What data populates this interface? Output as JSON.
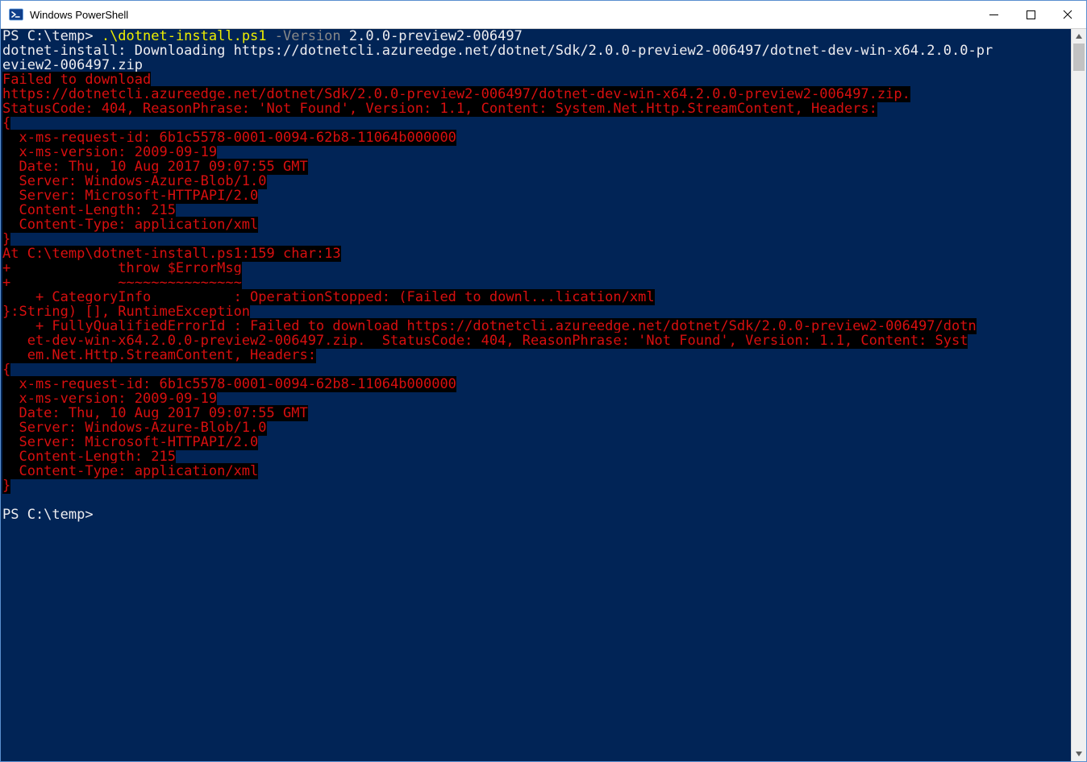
{
  "window": {
    "title": "Windows PowerShell"
  },
  "prompt1": {
    "ps": "PS C:\\temp> ",
    "cmd": ".\\dotnet-install.ps1 ",
    "flag": "-Version ",
    "arg": "2.0.0-preview2-006497"
  },
  "out": {
    "l1": "dotnet-install: Downloading https://dotnetcli.azureedge.net/dotnet/Sdk/2.0.0-preview2-006497/dotnet-dev-win-x64.2.0.0-pr",
    "l2": "eview2-006497.zip"
  },
  "err": {
    "e01": "Failed to download",
    "e02": "https://dotnetcli.azureedge.net/dotnet/Sdk/2.0.0-preview2-006497/dotnet-dev-win-x64.2.0.0-preview2-006497.zip.",
    "e03": "StatusCode: 404, ReasonPhrase: 'Not Found', Version: 1.1, Content: System.Net.Http.StreamContent, Headers:",
    "e04": "{",
    "e05": "  x-ms-request-id: 6b1c5578-0001-0094-62b8-11064b000000",
    "e06": "  x-ms-version: 2009-09-19",
    "e07": "  Date: Thu, 10 Aug 2017 09:07:55 GMT",
    "e08": "  Server: Windows-Azure-Blob/1.0",
    "e09": "  Server: Microsoft-HTTPAPI/2.0",
    "e10": "  Content-Length: 215",
    "e11": "  Content-Type: application/xml",
    "e12": "}",
    "e13": "At C:\\temp\\dotnet-install.ps1:159 char:13",
    "e14": "+             throw $ErrorMsg",
    "e15": "+             ~~~~~~~~~~~~~~~",
    "e16": "    + CategoryInfo          : OperationStopped: (Failed to downl...lication/xml",
    "e17": "}:String) [], RuntimeException",
    "e18": "    + FullyQualifiedErrorId : Failed to download https://dotnetcli.azureedge.net/dotnet/Sdk/2.0.0-preview2-006497/dotn",
    "e19": "   et-dev-win-x64.2.0.0-preview2-006497.zip.  StatusCode: 404, ReasonPhrase: 'Not Found', Version: 1.1, Content: Syst",
    "e20": "   em.Net.Http.StreamContent, Headers:",
    "e21": "{",
    "e22": "  x-ms-request-id: 6b1c5578-0001-0094-62b8-11064b000000",
    "e23": "  x-ms-version: 2009-09-19",
    "e24": "  Date: Thu, 10 Aug 2017 09:07:55 GMT",
    "e25": "  Server: Windows-Azure-Blob/1.0",
    "e26": "  Server: Microsoft-HTTPAPI/2.0",
    "e27": "  Content-Length: 215",
    "e28": "  Content-Type: application/xml",
    "e29": "}"
  },
  "prompt2": "PS C:\\temp>"
}
